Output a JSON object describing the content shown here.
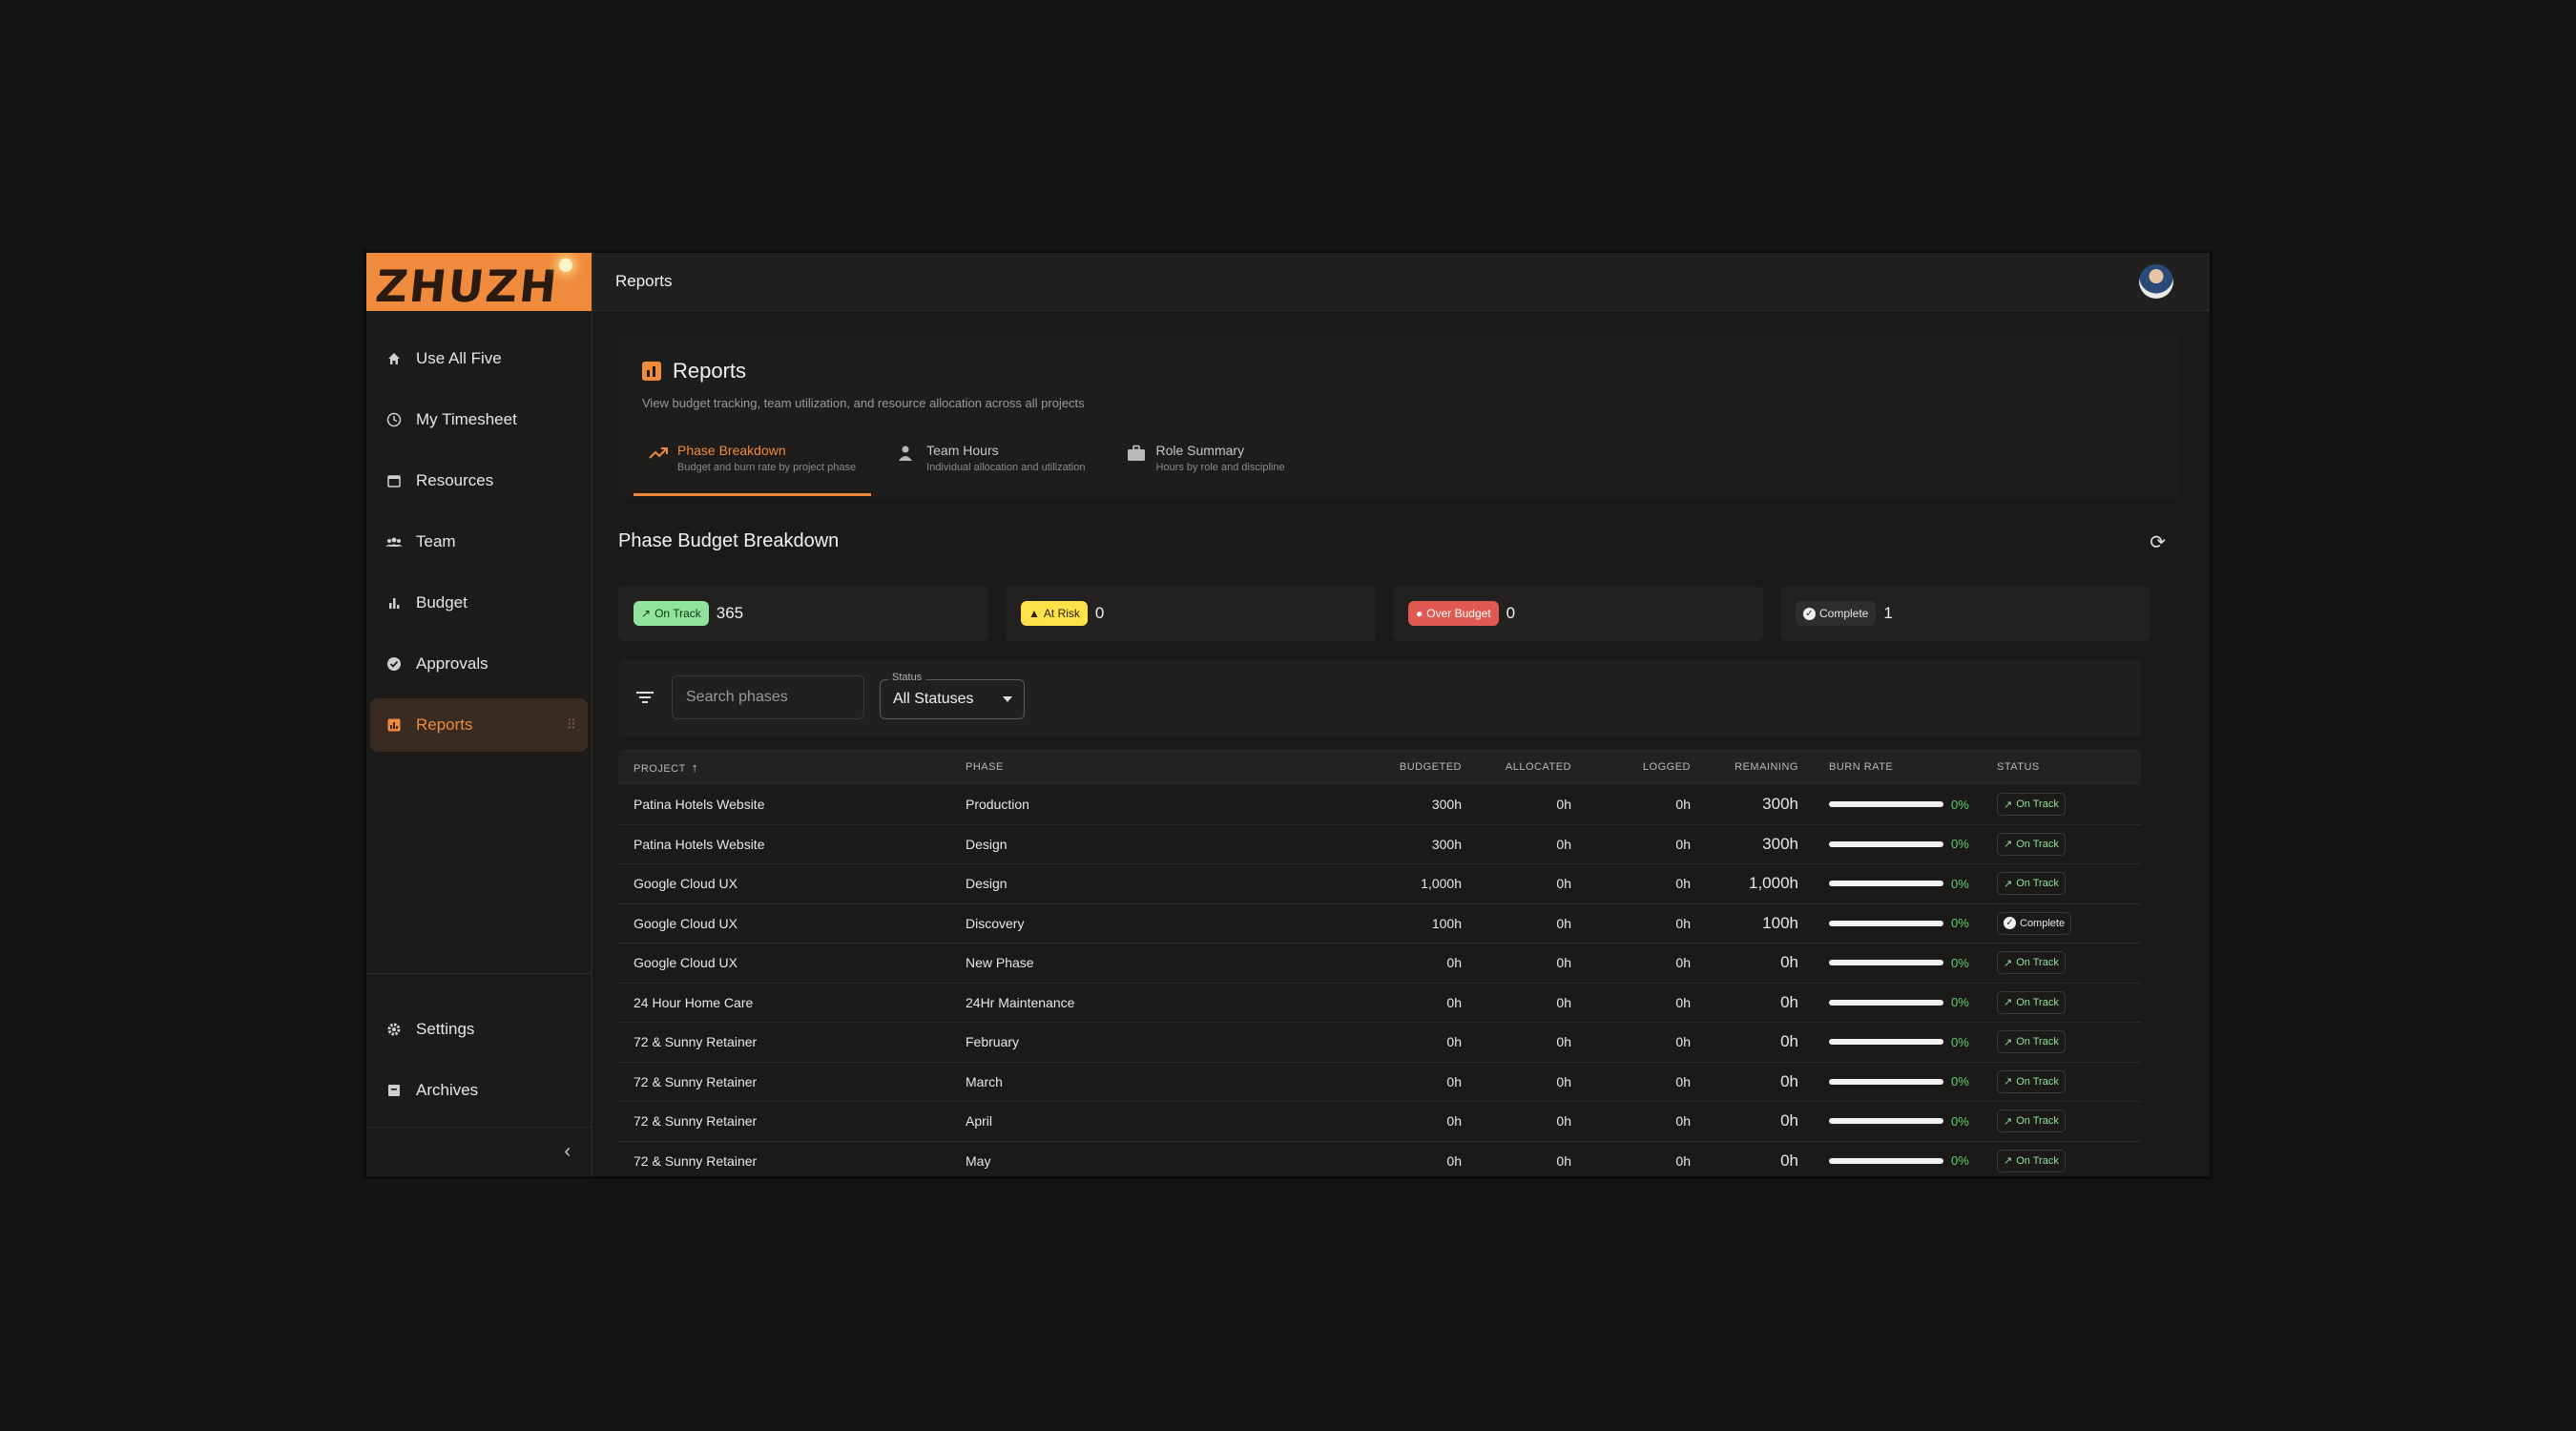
{
  "app": {
    "logo": "ZHUZH"
  },
  "topbar": {
    "title": "Reports"
  },
  "sidebar": {
    "items": [
      {
        "label": "Use All Five",
        "icon": "home-icon"
      },
      {
        "label": "My Timesheet",
        "icon": "clock-icon"
      },
      {
        "label": "Resources",
        "icon": "calendar-icon"
      },
      {
        "label": "Team",
        "icon": "people-icon"
      },
      {
        "label": "Budget",
        "icon": "bar-chart-icon"
      },
      {
        "label": "Approvals",
        "icon": "check-circle-icon"
      },
      {
        "label": "Reports",
        "icon": "report-icon",
        "active": true
      }
    ],
    "bottom": [
      {
        "label": "Settings",
        "icon": "gear-icon"
      },
      {
        "label": "Archives",
        "icon": "archive-icon"
      }
    ]
  },
  "reports": {
    "title": "Reports",
    "subtitle": "View budget tracking, team utilization, and resource allocation across all projects",
    "tabs": [
      {
        "label": "Phase Breakdown",
        "sub": "Budget and burn rate by project phase",
        "active": true
      },
      {
        "label": "Team Hours",
        "sub": "Individual allocation and utilization"
      },
      {
        "label": "Role Summary",
        "sub": "Hours by role and discipline"
      }
    ]
  },
  "section": {
    "title": "Phase Budget Breakdown",
    "summary": [
      {
        "label": "On Track",
        "count": "365"
      },
      {
        "label": "At Risk",
        "count": "0"
      },
      {
        "label": "Over Budget",
        "count": "0"
      },
      {
        "label": "Complete",
        "count": "1"
      }
    ],
    "search_placeholder": "Search phases",
    "status_label": "Status",
    "status_value": "All Statuses"
  },
  "table": {
    "headers": {
      "project": "PROJECT",
      "phase": "PHASE",
      "budgeted": "BUDGETED",
      "allocated": "ALLOCATED",
      "logged": "LOGGED",
      "remaining": "REMAINING",
      "burn": "BURN RATE",
      "status": "STATUS"
    },
    "rows": [
      {
        "project": "Patina Hotels Website",
        "phase": "Production",
        "budgeted": "300h",
        "allocated": "0h",
        "logged": "0h",
        "remaining": "300h",
        "burn": "0%",
        "status": "On Track"
      },
      {
        "project": "Patina Hotels Website",
        "phase": "Design",
        "budgeted": "300h",
        "allocated": "0h",
        "logged": "0h",
        "remaining": "300h",
        "burn": "0%",
        "status": "On Track"
      },
      {
        "project": "Google Cloud UX",
        "phase": "Design",
        "budgeted": "1,000h",
        "allocated": "0h",
        "logged": "0h",
        "remaining": "1,000h",
        "burn": "0%",
        "status": "On Track"
      },
      {
        "project": "Google Cloud UX",
        "phase": "Discovery",
        "budgeted": "100h",
        "allocated": "0h",
        "logged": "0h",
        "remaining": "100h",
        "burn": "0%",
        "status": "Complete"
      },
      {
        "project": "Google Cloud UX",
        "phase": "New Phase",
        "budgeted": "0h",
        "allocated": "0h",
        "logged": "0h",
        "remaining": "0h",
        "burn": "0%",
        "status": "On Track"
      },
      {
        "project": "24 Hour Home Care",
        "phase": "24Hr Maintenance",
        "budgeted": "0h",
        "allocated": "0h",
        "logged": "0h",
        "remaining": "0h",
        "burn": "0%",
        "status": "On Track"
      },
      {
        "project": "72 & Sunny Retainer",
        "phase": "February",
        "budgeted": "0h",
        "allocated": "0h",
        "logged": "0h",
        "remaining": "0h",
        "burn": "0%",
        "status": "On Track"
      },
      {
        "project": "72 & Sunny Retainer",
        "phase": "March",
        "budgeted": "0h",
        "allocated": "0h",
        "logged": "0h",
        "remaining": "0h",
        "burn": "0%",
        "status": "On Track"
      },
      {
        "project": "72 & Sunny Retainer",
        "phase": "April",
        "budgeted": "0h",
        "allocated": "0h",
        "logged": "0h",
        "remaining": "0h",
        "burn": "0%",
        "status": "On Track"
      },
      {
        "project": "72 & Sunny Retainer",
        "phase": "May",
        "budgeted": "0h",
        "allocated": "0h",
        "logged": "0h",
        "remaining": "0h",
        "burn": "0%",
        "status": "On Track"
      }
    ]
  },
  "colors": {
    "accent": "#f08a3c",
    "on_track": "#8fe39a",
    "at_risk": "#ffe14a",
    "over_budget": "#e05a52"
  }
}
